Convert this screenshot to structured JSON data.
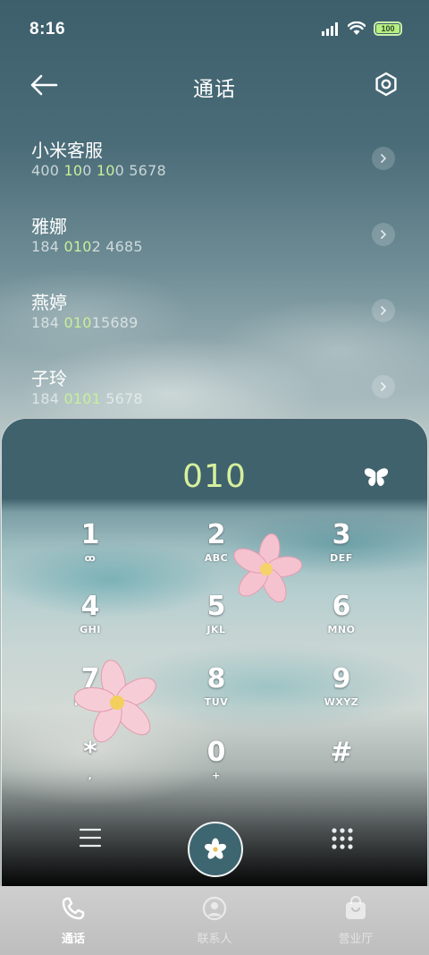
{
  "status_bar": {
    "time": "8:16",
    "battery": "100",
    "icons": [
      "signal-icon",
      "wifi-icon",
      "battery-icon"
    ]
  },
  "header": {
    "title": "通话",
    "back_icon": "arrow-left-icon",
    "settings_icon": "settings-icon"
  },
  "contacts": [
    {
      "name": "小米客服",
      "number_parts": [
        "400 ",
        "10",
        "0 ",
        "10",
        "0 5678"
      ]
    },
    {
      "name": "雅娜",
      "number_parts": [
        "184 ",
        "010",
        "2 4685",
        "",
        ""
      ]
    },
    {
      "name": "燕婷",
      "number_parts": [
        "184 ",
        "010",
        "15689",
        "",
        ""
      ]
    },
    {
      "name": "子玲",
      "number_parts": [
        "184 ",
        "0101",
        " 5678",
        "",
        ""
      ]
    }
  ],
  "dialer": {
    "input_value": "010",
    "keys": [
      {
        "digit": "1",
        "letters": "ꝏ"
      },
      {
        "digit": "2",
        "letters": "ABC"
      },
      {
        "digit": "3",
        "letters": "DEF"
      },
      {
        "digit": "4",
        "letters": "GHI"
      },
      {
        "digit": "5",
        "letters": "JKL"
      },
      {
        "digit": "6",
        "letters": "MNO"
      },
      {
        "digit": "7",
        "letters": "PQRS"
      },
      {
        "digit": "8",
        "letters": "TUV"
      },
      {
        "digit": "9",
        "letters": "WXYZ"
      },
      {
        "digit": "*",
        "letters": ","
      },
      {
        "digit": "0",
        "letters": "+"
      },
      {
        "digit": "#",
        "letters": ""
      }
    ]
  },
  "bottom_nav": {
    "items": [
      {
        "label": "通话",
        "icon": "phone-icon",
        "active": true
      },
      {
        "label": "联系人",
        "icon": "person-icon",
        "active": false
      },
      {
        "label": "营业厅",
        "icon": "store-icon",
        "active": false
      }
    ]
  },
  "colors": {
    "highlight": "#c9ef9a",
    "dial_text": "#d6ef9e",
    "call_button": "#3e6671"
  }
}
